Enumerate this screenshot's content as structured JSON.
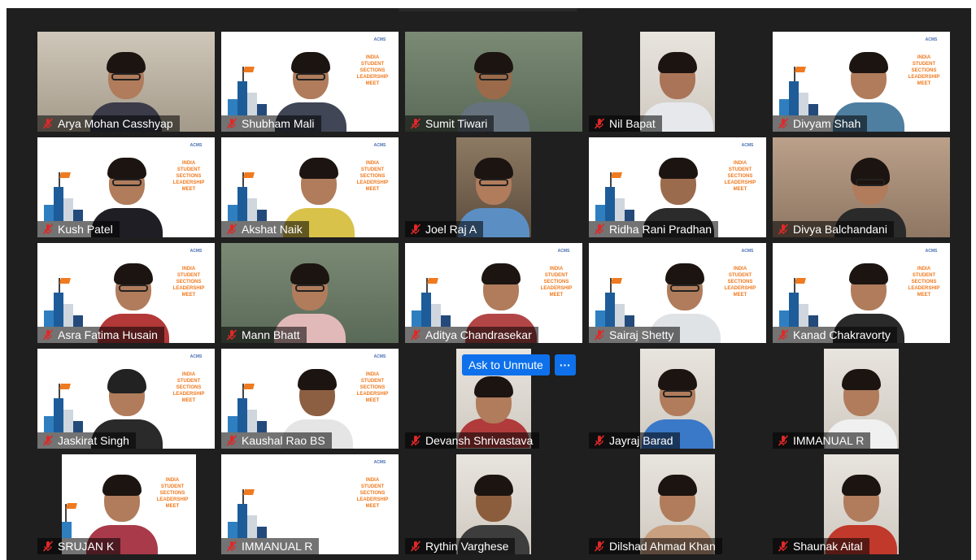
{
  "meeting": {
    "unmute_label": "Ask to Unmute",
    "more_label": "···",
    "slide_logo": "ACMS",
    "slide_text": "INDIA STUDENT SECTIONS LEADERSHIP MEET",
    "accent_color": "#0e71eb",
    "mute_icon": "muted-mic-icon",
    "participants": [
      {
        "name": "Arya Mohan Casshyap"
      },
      {
        "name": "Shubham Mali"
      },
      {
        "name": "Sumit Tiwari"
      },
      {
        "name": "Nil Bapat"
      },
      {
        "name": "Divyam Shah"
      },
      {
        "name": "Kush Patel"
      },
      {
        "name": "Akshat Naik"
      },
      {
        "name": "Joel Raj A"
      },
      {
        "name": "Ridha Rani Pradhan"
      },
      {
        "name": "Divya Balchandani"
      },
      {
        "name": "Asra Fatima Husain"
      },
      {
        "name": "Mann Bhatt"
      },
      {
        "name": "Aditya Chandrasekar"
      },
      {
        "name": "Sairaj Shetty"
      },
      {
        "name": "Kanad Chakravorty"
      },
      {
        "name": "Jaskirat Singh"
      },
      {
        "name": "Kaushal Rao BS"
      },
      {
        "name": "Devansh Shrivastava"
      },
      {
        "name": "Jayraj Barad"
      },
      {
        "name": "IMMANUAL R"
      },
      {
        "name": "SRUJAN K"
      },
      {
        "name": "IMMANUAL R"
      },
      {
        "name": "Rythin Varghese"
      },
      {
        "name": "Dilshad Ahmad Khan"
      },
      {
        "name": "Shaunak Aital"
      }
    ]
  }
}
